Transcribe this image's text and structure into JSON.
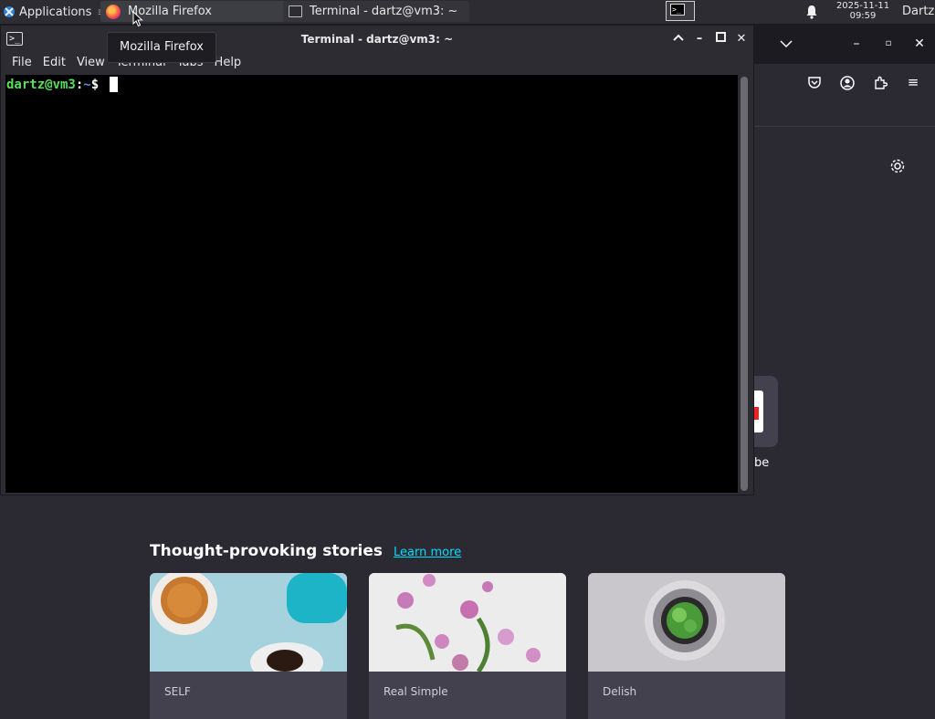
{
  "taskbar": {
    "applications_label": "Applications",
    "separator": "≡",
    "tasks": [
      {
        "label": "Mozilla Firefox",
        "icon": "firefox-icon"
      },
      {
        "label": "Terminal - dartz@vm3: ~",
        "icon": "terminal-icon"
      }
    ],
    "workspace_glyph": ">_",
    "clock": {
      "date": "2025-11-11",
      "time": "09:59"
    },
    "user": "Dartz"
  },
  "tooltip": {
    "text": "Mozilla Firefox"
  },
  "terminal": {
    "title": "Terminal - dartz@vm3: ~",
    "menu": [
      "File",
      "Edit",
      "View",
      "Terminal",
      "Tabs",
      "Help"
    ],
    "prompt": {
      "user_host": "dartz@vm3",
      "colon": ":",
      "path": "~",
      "symbol": "$ "
    }
  },
  "firefox": {
    "shortcut_label": "be",
    "stories": {
      "title": "Thought-provoking stories",
      "learn_more": "Learn more",
      "cards": [
        {
          "source": "SELF"
        },
        {
          "source": "Real Simple"
        },
        {
          "source": "Delish"
        }
      ]
    }
  },
  "colors": {
    "accent_link": "#00ddff",
    "prompt_user": "#54e05b",
    "prompt_path": "#5c8ee8",
    "firefox_bg": "#2b2a33"
  }
}
